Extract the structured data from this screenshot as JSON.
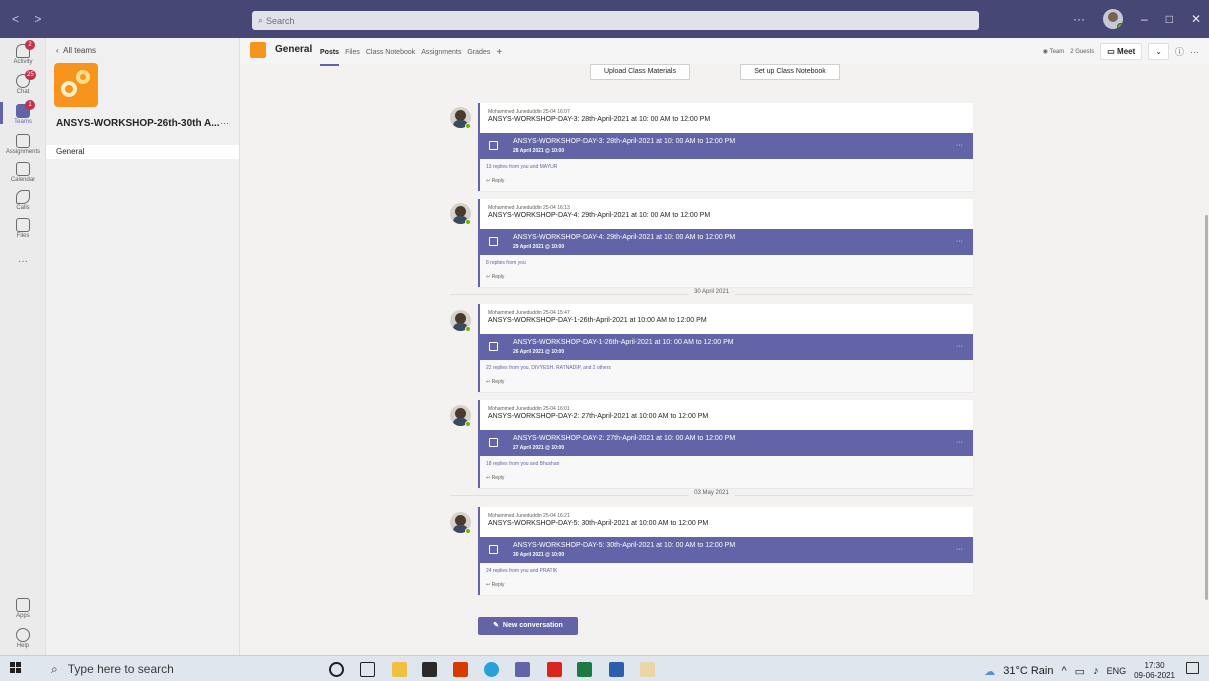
{
  "titlebar": {
    "nav": "< >",
    "search_placeholder": "Search",
    "more": "···",
    "min": "–",
    "max": "□",
    "close": "✕"
  },
  "appbar": {
    "items": [
      {
        "label": "Activity",
        "icon": "bell-icon",
        "badge": "2"
      },
      {
        "label": "Chat",
        "icon": "chat-icon",
        "badge": "25"
      },
      {
        "label": "Teams",
        "icon": "teams-icon",
        "badge": "1"
      },
      {
        "label": "Assignments",
        "icon": "assignments-icon"
      },
      {
        "label": "Calendar",
        "icon": "calendar-icon"
      },
      {
        "label": "Calls",
        "icon": "phone-icon"
      },
      {
        "label": "Files",
        "icon": "file-icon"
      },
      {
        "label": "···",
        "icon": "more-icon"
      },
      {
        "label": "Apps",
        "icon": "apps-icon"
      },
      {
        "label": "Help",
        "icon": "help-icon"
      }
    ]
  },
  "teampanel": {
    "all_teams": "All teams",
    "team_name": "ANSYS-WORKSHOP-26th-30th A...",
    "more": "···",
    "channel": "General"
  },
  "header": {
    "channel": "General",
    "tabs": [
      "Posts",
      "Files",
      "Class Notebook",
      "Assignments",
      "Grades",
      "+"
    ],
    "team_label": "Team",
    "guests_label": "2 Guests",
    "meet_label": "Meet",
    "info": "ⓘ",
    "more": "···"
  },
  "feed": {
    "upload_btn": "Upload Class Materials",
    "notebook_btn": "Set up Class Notebook",
    "posts": [
      {
        "meta": "Mohammed Juneduddin  25-04 16:07",
        "subject": "ANSYS-WORKSHOP-DAY-3:   28th-April-2021 at 10: 00 AM to 12:00 PM",
        "card_title": "ANSYS-WORKSHOP-DAY-3: 28th-April-2021 at 10: 00 AM to 12:00 PM",
        "card_date": "28 April 2021 @ 10:00",
        "replies": "13 replies from you and MAYUR",
        "reply": "Reply"
      },
      {
        "meta": "Mohammed Juneduddin  25-04 16:13",
        "subject": "ANSYS-WORKSHOP-DAY-4:   29th-April-2021 at 10: 00 AM to 12:00 PM",
        "card_title": "ANSYS-WORKSHOP-DAY-4: 29th-April-2021 at 10: 00 AM to 12:00 PM",
        "card_date": "29 April 2021 @ 10:00",
        "replies": "8 replies from you",
        "reply": "Reply"
      },
      {
        "meta": "Mohammed Juneduddin  25-04 15:47",
        "subject": "ANSYS-WORKSHOP-DAY-1-26th-April-2021 at 10:00 AM to 12:00 PM",
        "card_title": "ANSYS-WORKSHOP-DAY-1-26th-April-2021 at 10: 00 AM to 12:00 PM",
        "card_date": "26 April 2021 @ 10:00",
        "replies": "22 replies from you, DIVYESH, RATNADIP, and 2 others",
        "reply": "Reply"
      },
      {
        "meta": "Mohammed Juneduddin  25-04 16:01",
        "subject": "ANSYS-WORKSHOP-DAY-2:   27th-April-2021 at 10:00 AM to 12:00 PM",
        "card_title": "ANSYS-WORKSHOP-DAY-2: 27th-April-2021 at 10: 00 AM to 12:00 PM",
        "card_date": "27 April 2021 @ 10:00",
        "replies": "18 replies from you and Bhushan",
        "reply": "Reply"
      },
      {
        "meta": "Mohammed Juneduddin  25-04 16:21",
        "subject": "ANSYS-WORKSHOP-DAY-5:   30th-April-2021 at 10:00 AM to 12:00 PM",
        "card_title": "ANSYS-WORKSHOP-DAY-5: 30th-April-2021 at 10: 00 AM to 12:00 PM",
        "card_date": "30 April 2021 @ 10:00",
        "replies": "24 replies from you and PRATIK",
        "reply": "Reply"
      }
    ],
    "dividers": [
      "30 April 2021",
      "03 May 2021"
    ],
    "new_conversation": "New conversation"
  },
  "taskbar": {
    "search": "Type here to search",
    "weather": "31°C Rain",
    "lang": "ENG",
    "time": "17:30",
    "date": "09-06-2021",
    "pinned": [
      "cortana-icon",
      "task-view-icon",
      "file-explorer-icon",
      "store-icon",
      "office-icon",
      "edge-icon",
      "teams-icon",
      "acrobat-icon",
      "excel-icon",
      "word-icon",
      "paint-icon"
    ]
  },
  "colors": {
    "teams_purple": "#6264a7",
    "titlebar": "#464775",
    "team_orange": "#f7941d"
  }
}
